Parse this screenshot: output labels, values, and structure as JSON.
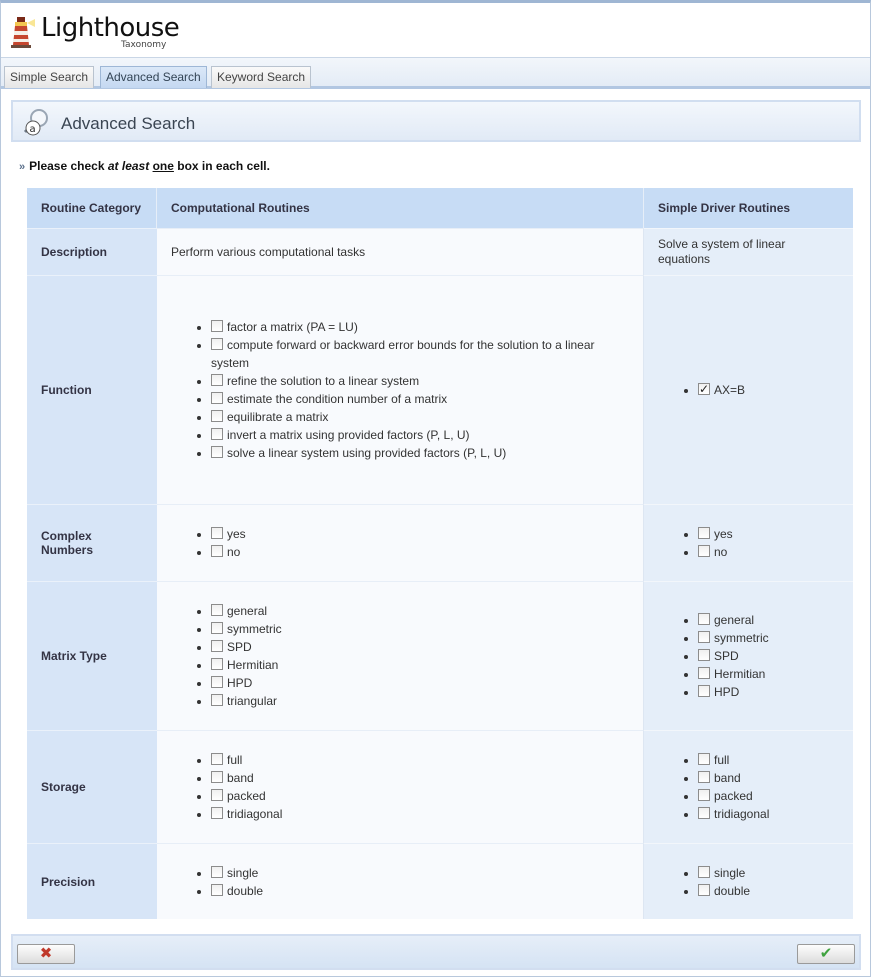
{
  "header": {
    "title": "Lighthouse",
    "subtitle": "Taxonomy",
    "logo_icon": "lighthouse-icon"
  },
  "tabs": [
    {
      "label": "Simple Search",
      "active": false
    },
    {
      "label": "Advanced Search",
      "active": true
    },
    {
      "label": "Keyword Search",
      "active": false
    }
  ],
  "panel": {
    "title": "Advanced Search",
    "icon": "search-magnifier-icon"
  },
  "hint": {
    "lead": "Please check ",
    "em": "at least",
    "space1": " ",
    "u": "one",
    "tail": " box in each cell."
  },
  "table": {
    "headers": {
      "category": "Routine Category",
      "computational": "Computational Routines",
      "driver": "Simple Driver Routines"
    },
    "description": {
      "label": "Description",
      "computational": "Perform various computational tasks",
      "driver": "Solve a system of linear equations"
    },
    "function": {
      "label": "Function",
      "computational": [
        "factor a matrix (PA = LU)",
        "compute forward or backward error bounds for the solution to a linear system",
        "refine the solution to a linear system",
        "estimate the condition number of a matrix",
        "equilibrate a matrix",
        "invert a matrix using provided factors (P, L, U)",
        "solve a linear system using provided factors (P, L, U)"
      ],
      "driver": [
        "AX=B"
      ],
      "driver_checked": [
        true
      ]
    },
    "complex": {
      "label": "Complex Numbers",
      "computational": [
        "yes",
        "no"
      ],
      "driver": [
        "yes",
        "no"
      ]
    },
    "matrix_type": {
      "label": "Matrix Type",
      "computational": [
        "general",
        "symmetric",
        "SPD",
        "Hermitian",
        "HPD",
        "triangular"
      ],
      "driver": [
        "general",
        "symmetric",
        "SPD",
        "Hermitian",
        "HPD"
      ]
    },
    "storage": {
      "label": "Storage",
      "computational": [
        "full",
        "band",
        "packed",
        "tridiagonal"
      ],
      "driver": [
        "full",
        "band",
        "packed",
        "tridiagonal"
      ]
    },
    "precision": {
      "label": "Precision",
      "computational": [
        "single",
        "double"
      ],
      "driver": [
        "single",
        "double"
      ]
    }
  },
  "footer": {
    "cancel_icon": "x-icon",
    "ok_icon": "checkmark-icon",
    "cancel_color": "#c0392b",
    "ok_color": "#3fa23f"
  }
}
